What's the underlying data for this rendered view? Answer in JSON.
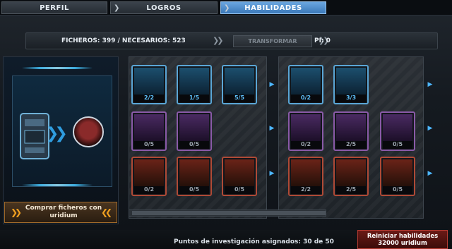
{
  "tabs": [
    {
      "label": "PERFIL"
    },
    {
      "label": "LOGROS"
    },
    {
      "label": "HABILIDADES"
    }
  ],
  "info": {
    "files": "FICHEROS: 399 / NECESARIOS: 523",
    "transform": "TRANSFORMAR",
    "pi": "PI: 0"
  },
  "buy": {
    "label": "Comprar ficheros con uridium"
  },
  "skills_left": [
    {
      "count": "2/2",
      "icon": "solar-panel-icon",
      "style": "blue"
    },
    {
      "count": "1/5",
      "icon": "wrench-icon",
      "style": "blue"
    },
    {
      "count": "5/5",
      "icon": "ship-radar-icon",
      "style": "blue"
    },
    {
      "count": "0/5",
      "icon": "soldier-portrait-icon",
      "style": "purple"
    },
    {
      "count": "0/5",
      "icon": "drone-tool-icon",
      "style": "purple"
    },
    {
      "count": "0/2",
      "icon": "skull-icon",
      "style": "red"
    },
    {
      "count": "0/5",
      "icon": "explosion-icon",
      "style": "red"
    },
    {
      "count": "0/5",
      "icon": "chili-pepper-icon",
      "style": "red"
    }
  ],
  "skills_right": [
    {
      "count": "0/2",
      "icon": "laser-ship-icon",
      "style": "blue"
    },
    {
      "count": "3/3",
      "icon": "solar-panel-icon",
      "style": "blue"
    },
    {
      "count": "0/2",
      "icon": "cube-icon",
      "style": "purple"
    },
    {
      "count": "2/5",
      "icon": "fist-icon",
      "style": "purple"
    },
    {
      "count": "0/5",
      "icon": "laser-beam-icon",
      "style": "purple"
    },
    {
      "count": "2/2",
      "icon": "face-portrait-icon",
      "style": "red"
    },
    {
      "count": "2/5",
      "icon": "rifle-icon",
      "style": "red"
    },
    {
      "count": "0/5",
      "icon": "lightsaber-icon",
      "style": "red"
    }
  ],
  "footer": {
    "text": "Puntos de investigación asignados: 30 de 50"
  },
  "reset": {
    "line1": "Reiniciar habilidades",
    "line2": "32000 uridium"
  },
  "colors": {
    "accent_blue": "#4db6ff",
    "tab_active": "#3a78b8",
    "reset_red": "#6a1a16",
    "buy_orange": "#f0a020"
  }
}
